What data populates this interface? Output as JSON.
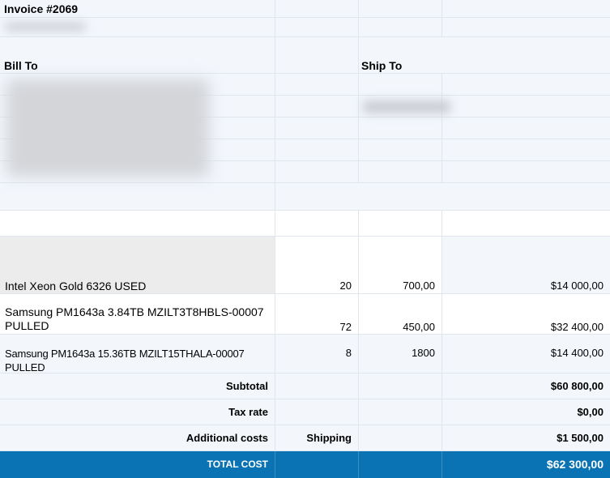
{
  "invoice": {
    "title": "Invoice #2069",
    "bill_to_label": "Bill To",
    "ship_to_label": "Ship To"
  },
  "items": [
    {
      "description": "Intel Xeon Gold 6326 USED",
      "qty": "20",
      "price": "700,00",
      "amount": "$14 000,00"
    },
    {
      "description_line1": "Samsung PM1643a 3.84TB MZILT3T8HBLS-00007",
      "description_line2": "PULLED",
      "qty": "72",
      "price": "450,00",
      "amount": "$32 400,00"
    },
    {
      "description": "Samsung PM1643a 15.36TB MZILT15THALA-00007 PULLED",
      "qty": "8",
      "price": "1800",
      "amount": "$14 400,00"
    }
  ],
  "summary": {
    "subtotal_label": "Subtotal",
    "subtotal_value": "$60 800,00",
    "tax_label": "Tax rate",
    "tax_value": "$0,00",
    "additional_label": "Additional costs",
    "shipping_label": "Shipping",
    "shipping_value": "$1 500,00",
    "total_label": "TOTAL COST",
    "total_value": "$62 300,00"
  },
  "colors": {
    "total_bar": "#0a73b3",
    "row_light": "#f3f7fc",
    "gridline": "#dfe6ee"
  }
}
